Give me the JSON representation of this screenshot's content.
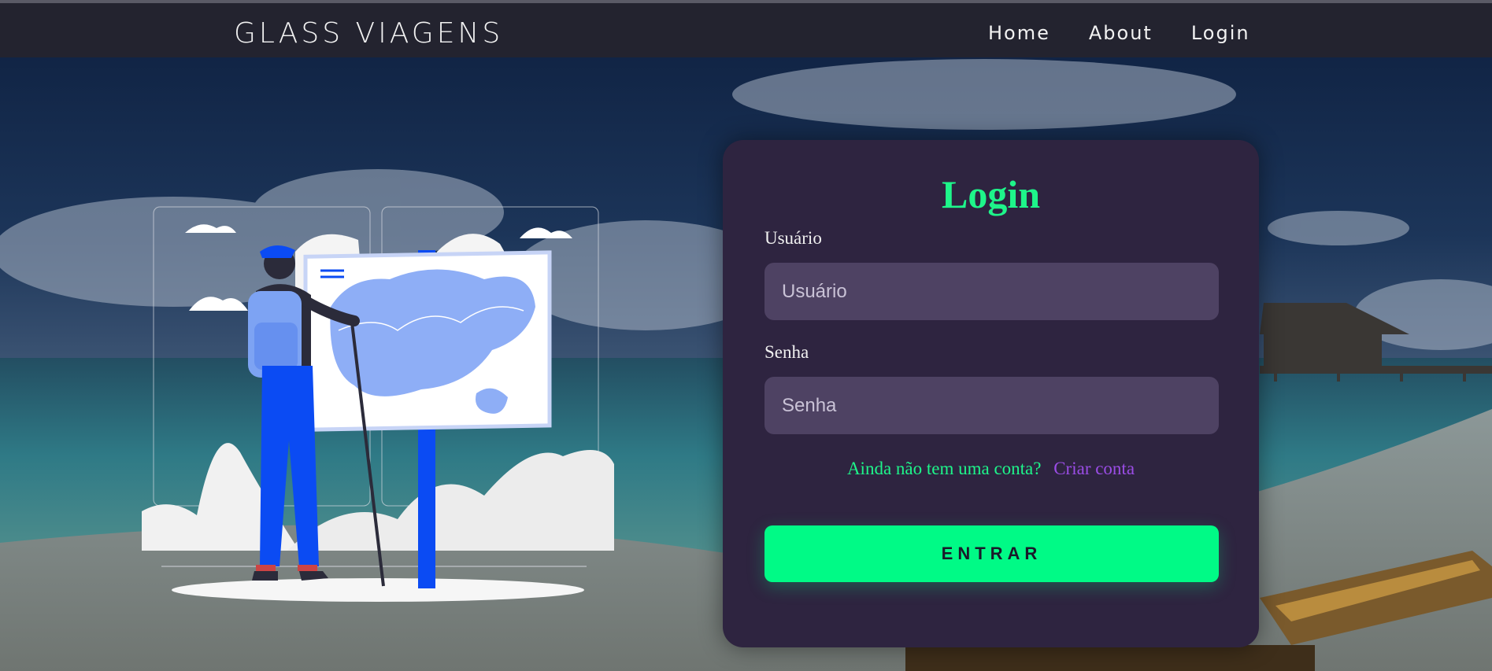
{
  "header": {
    "brand": "GLASS VIAGENS",
    "nav": [
      {
        "label": "Home"
      },
      {
        "label": "About"
      },
      {
        "label": "Login"
      }
    ]
  },
  "login": {
    "title": "Login",
    "username_label": "Usuário",
    "username_placeholder": "Usuário",
    "password_label": "Senha",
    "password_placeholder": "Senha",
    "signup_question": "Ainda não tem uma conta?",
    "signup_link": "Criar conta",
    "submit_label": "ENTRAR"
  },
  "colors": {
    "accent": "#1ef58a",
    "button": "#00fa86",
    "link": "#9b4de6",
    "card": "#2e2440",
    "topbar": "#23232f"
  },
  "icons": [
    "traveler-illustration",
    "map-board-icon"
  ]
}
